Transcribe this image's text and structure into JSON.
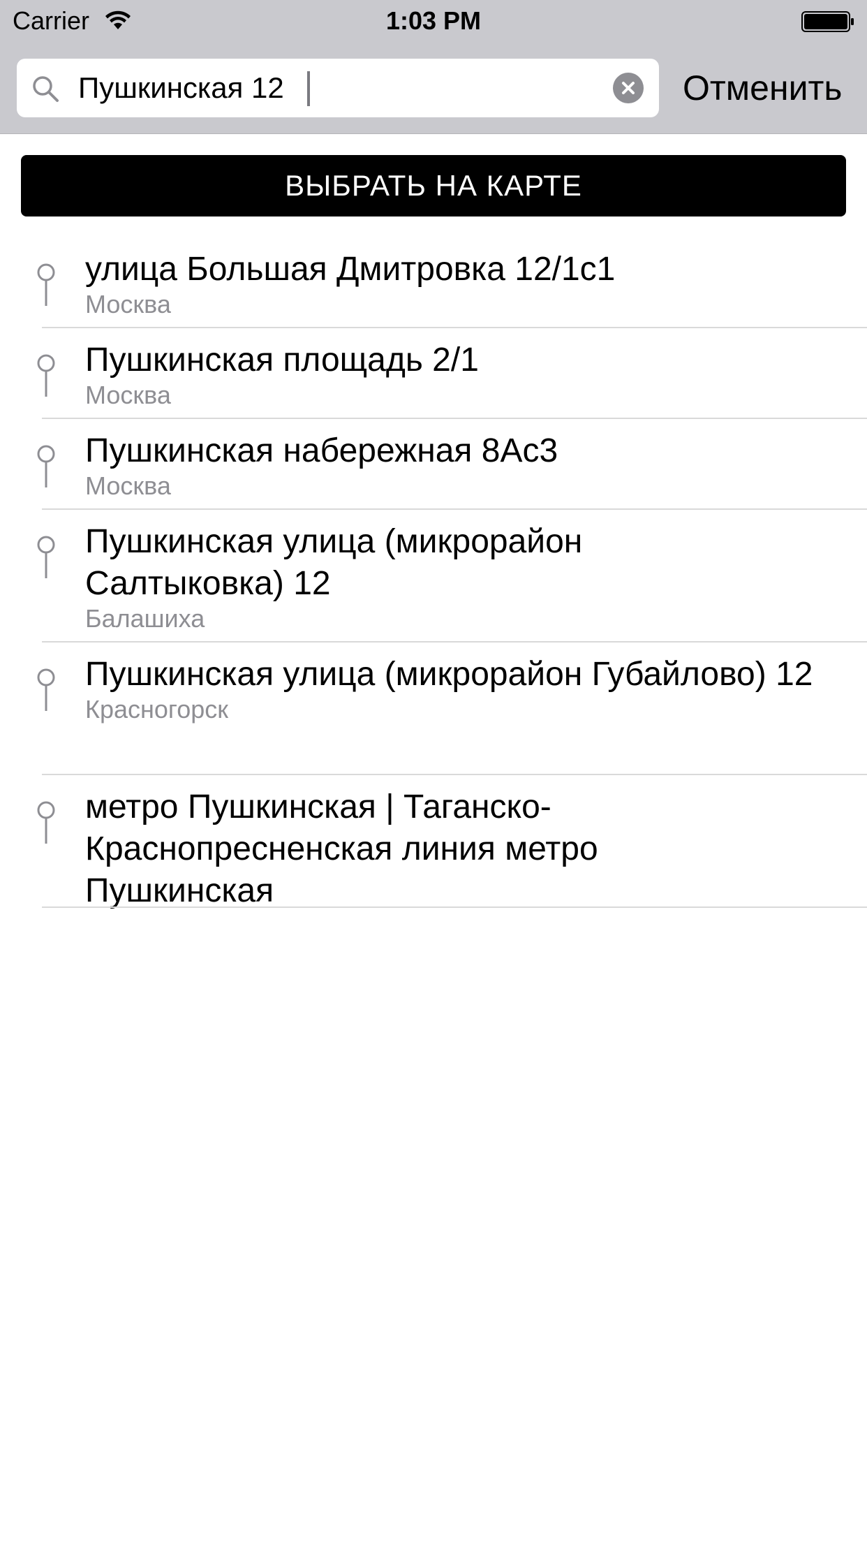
{
  "status_bar": {
    "carrier": "Carrier",
    "time": "1:03 PM",
    "wifi_icon": "wifi-icon",
    "battery_icon": "battery-icon"
  },
  "search": {
    "value": "Пушкинская 12",
    "cancel_label": "Отменить",
    "search_icon": "search-icon",
    "clear_icon": "clear-icon"
  },
  "map_button": {
    "label": "ВЫБРАТЬ НА КАРТЕ"
  },
  "results": [
    {
      "title": "улица Большая Дмитровка 12/1с1",
      "subtitle": "Москва"
    },
    {
      "title": "Пушкинская площадь 2/1",
      "subtitle": "Москва"
    },
    {
      "title": "Пушкинская набережная 8Ас3",
      "subtitle": "Москва"
    },
    {
      "title": "Пушкинская улица (микрорайон Салтыковка) 12",
      "subtitle": "Балашиха"
    },
    {
      "title": "Пушкинская улица (микрорайон Губайлово) 12",
      "subtitle": "Красногорск"
    },
    {
      "title": "метро Пушкинская | Таганско-Краснопресненская линия метро Пушкинская",
      "subtitle": ""
    }
  ],
  "colors": {
    "top_background": "#c9c9ce",
    "subtitle_gray": "#8e8e93",
    "button_black": "#000000",
    "separator": "#d9d9d9"
  }
}
